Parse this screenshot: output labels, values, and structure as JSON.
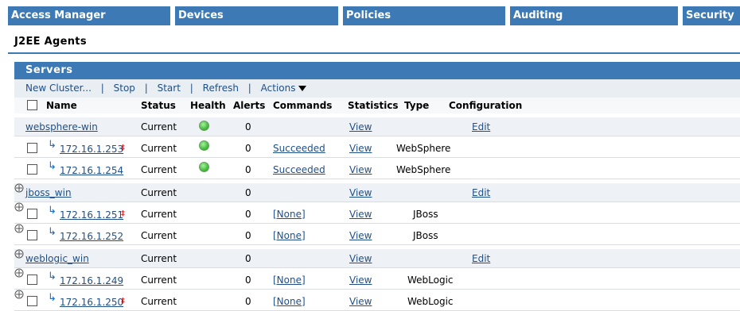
{
  "nav": {
    "tabs": [
      {
        "label": "Access Manager"
      },
      {
        "label": "Devices"
      },
      {
        "label": "Policies"
      },
      {
        "label": "Auditing"
      },
      {
        "label": "Security"
      }
    ]
  },
  "page": {
    "subtitle": "J2EE Agents"
  },
  "panel": {
    "title": "Servers"
  },
  "toolbar": {
    "new_cluster": "New Cluster...",
    "stop": "Stop",
    "start": "Start",
    "refresh": "Refresh",
    "actions": "Actions"
  },
  "columns": {
    "name": "Name",
    "status": "Status",
    "health": "Health",
    "alerts": "Alerts",
    "commands": "Commands",
    "statistics": "Statistics",
    "type": "Type",
    "configuration": "Configuration"
  },
  "rows": [
    {
      "name": "websphere-win",
      "status": "Current",
      "alerts": "0",
      "statistics": "View",
      "configuration": "Edit"
    },
    {
      "name": "172.16.1.253",
      "status": "Current",
      "alerts": "0",
      "commands": "Succeeded",
      "statistics": "View",
      "type": "WebSphere"
    },
    {
      "name": "172.16.1.254",
      "status": "Current",
      "alerts": "0",
      "commands": "Succeeded",
      "statistics": "View",
      "type": "WebSphere"
    },
    {
      "name": "jboss_win",
      "status": "Current",
      "alerts": "0",
      "statistics": "View",
      "configuration": "Edit"
    },
    {
      "name": "172.16.1.251",
      "status": "Current",
      "alerts": "0",
      "commands": "[None]",
      "statistics": "View",
      "type": "JBoss"
    },
    {
      "name": "172.16.1.252",
      "status": "Current",
      "alerts": "0",
      "commands": "[None]",
      "statistics": "View",
      "type": "JBoss"
    },
    {
      "name": "weblogic_win",
      "status": "Current",
      "alerts": "0",
      "statistics": "View",
      "configuration": "Edit"
    },
    {
      "name": "172.16.1.249",
      "status": "Current",
      "alerts": "0",
      "commands": "[None]",
      "statistics": "View",
      "type": "WebLogic"
    },
    {
      "name": "172.16.1.250",
      "status": "Current",
      "alerts": "0",
      "commands": "[None]",
      "statistics": "View",
      "type": "WebLogic"
    }
  ],
  "icons": {
    "health_ok": "green-status-icon",
    "health_unknown": "unknown-status-icon",
    "child_arrow": "child-arrow-icon",
    "marker": "double-dagger-icon"
  },
  "colors": {
    "accent": "#3d7ab5",
    "link": "#1f4f88",
    "health_ok": "#35b52c"
  }
}
